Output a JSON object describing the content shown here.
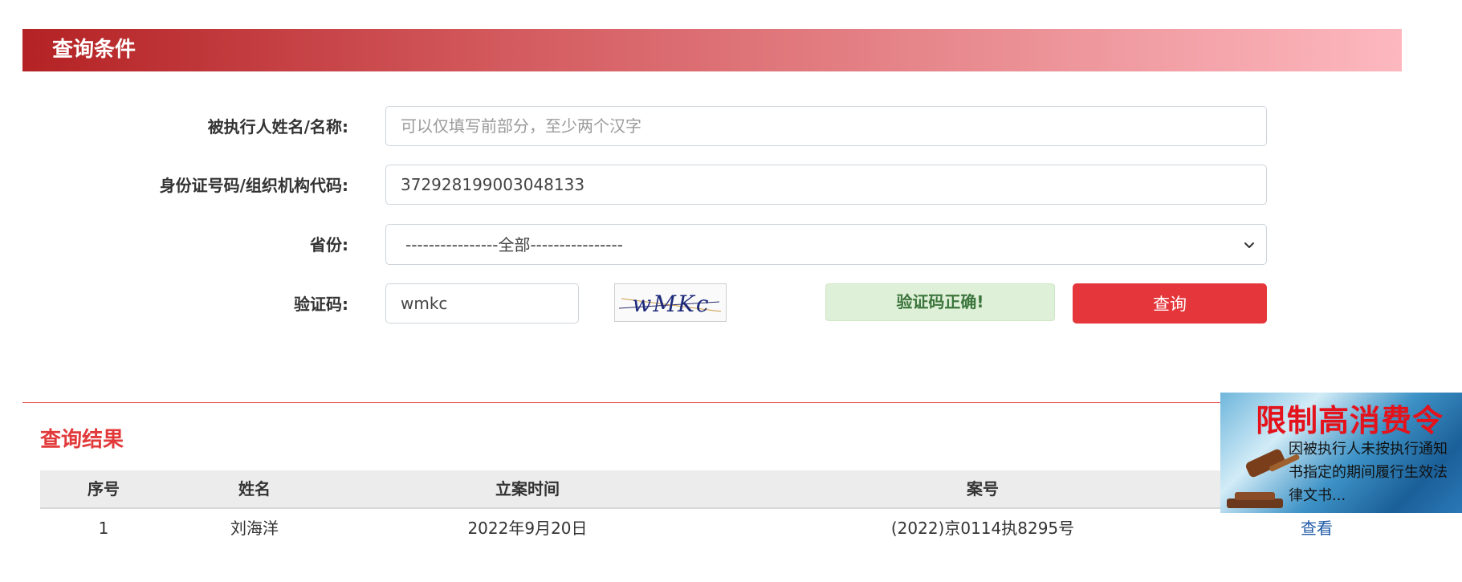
{
  "conditions": {
    "title": "查询条件",
    "name_label": "被执行人姓名/名称:",
    "name_placeholder": "可以仅填写前部分，至少两个汉字",
    "name_value": "",
    "id_label": "身份证号码/组织机构代码:",
    "id_value": "372928199003048133",
    "province_label": "省份:",
    "province_value": "----------------全部----------------",
    "captcha_label": "验证码:",
    "captcha_value": "wmkc",
    "captcha_image_text": "wMKc",
    "captcha_status": "验证码正确!",
    "query_button": "查询"
  },
  "results": {
    "title": "查询结果",
    "columns": [
      "序号",
      "姓名",
      "立案时间",
      "案号"
    ],
    "rows": [
      {
        "index": "1",
        "name": "刘海洋",
        "date": "2022年9月20日",
        "case_no": "(2022)京0114执8295号",
        "action": "查看"
      }
    ]
  },
  "ad": {
    "title": "限制高消费令",
    "text": "因被执行人未按执行通知书指定的期间履行生效法律文书..."
  },
  "colors": {
    "header_red": "#b42224",
    "button_red": "#e4363b",
    "success_bg": "#dff0d8",
    "link_blue": "#1f5aa6"
  }
}
